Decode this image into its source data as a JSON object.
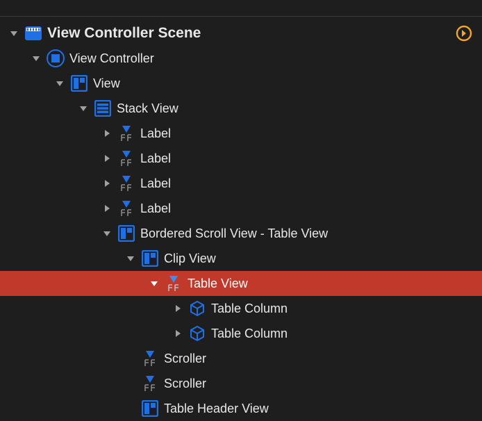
{
  "scene": {
    "title": "View Controller Scene"
  },
  "tree": {
    "viewController": "View Controller",
    "view": "View",
    "stackView": "Stack View",
    "label1": "Label",
    "label2": "Label",
    "label3": "Label",
    "label4": "Label",
    "scrollView": "Bordered Scroll View - Table View",
    "clipView": "Clip View",
    "tableView": "Table View",
    "tableColumn1": "Table Column",
    "tableColumn2": "Table Column",
    "scroller1": "Scroller",
    "scroller2": "Scroller",
    "tableHeaderView": "Table Header View"
  }
}
